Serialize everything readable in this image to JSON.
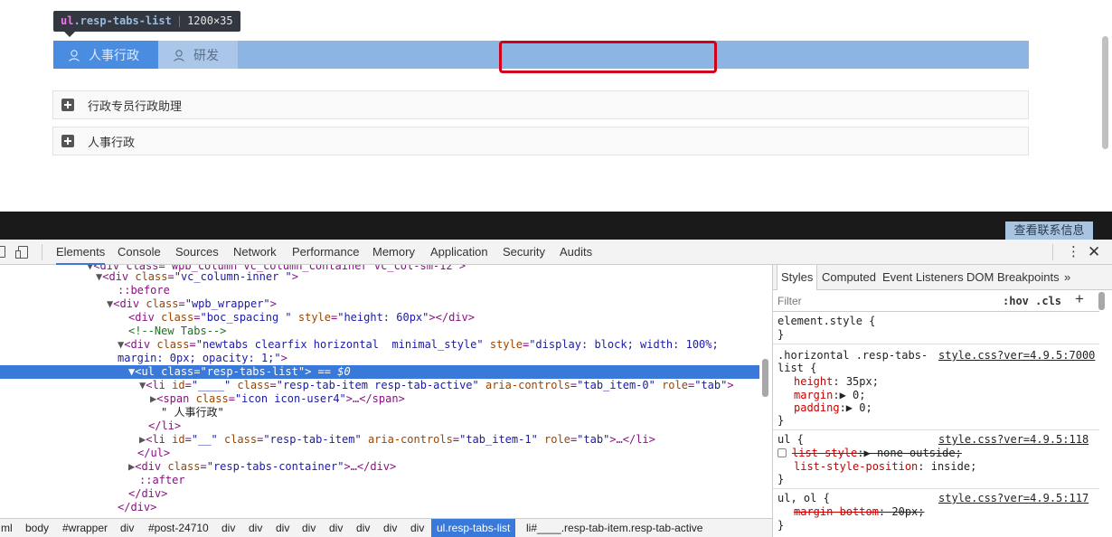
{
  "page": {
    "tooltip": {
      "tag": "ul",
      "class": ".resp-tabs-list",
      "dims": "1200×35"
    },
    "tabs": [
      {
        "label": "人事行政",
        "icon": "user-icon",
        "active": true
      },
      {
        "label": "研发",
        "icon": "user-icon",
        "active": false
      }
    ],
    "accordion": [
      {
        "label": "行政专员行政助理",
        "icon": "plus-icon"
      },
      {
        "label": "人事行政",
        "icon": "plus-icon"
      }
    ],
    "contact_button": "查看联系信息",
    "colors": {
      "tab_bar": "#8cb5e4",
      "tab_active": "#4a8ce0",
      "highlight": "#d0021b"
    }
  },
  "devtools": {
    "tabs": [
      "Elements",
      "Console",
      "Sources",
      "Network",
      "Performance",
      "Memory",
      "Application",
      "Security",
      "Audits"
    ],
    "selected_tab": "Elements",
    "dom_lines": {
      "l0": "<div class=\"wpb_column vc_column_container vc_col-sm-12\">",
      "l1_tag_open": "<div ",
      "l1_attr": "class",
      "l1_val": "\"vc_column-inner \"",
      "l1_close": ">",
      "l2": "::before",
      "l3_attr": "class",
      "l3_val": "\"wpb_wrapper\"",
      "l4_attr1": "class",
      "l4_val1": "\"boc_spacing \"",
      "l4_attr2": "style",
      "l4_val2": "\"height: 60px\"",
      "l5": "<!--New Tabs-->",
      "l6_attr1": "class",
      "l6_val1": "\"newtabs clearfix horizontal  minimal_style\"",
      "l6_attr2": "style",
      "l6_val2": "\"display: block; width: 100%;",
      "l7_val": "margin: 0px; opacity: 1;\"",
      "l8_attr": "class",
      "l8_val": "\"resp-tabs-list\"",
      "l8_eq": " == $0",
      "l9_attr1": "id",
      "l9_val1": "\"____\"",
      "l9_attr2": "class",
      "l9_val2": "\"resp-tab-item resp-tab-active\"",
      "l9_attr3": "aria-controls",
      "l9_val3": "\"tab_item-0\"",
      "l9_attr4": "role",
      "l9_val4": "\"tab\"",
      "l10_attr": "class",
      "l10_val": "\"icon icon-user4\"",
      "l11": "\" 人事行政\"",
      "l13_attr1": "id",
      "l13_val1": "\"__\"",
      "l13_attr2": "class",
      "l13_val2": "\"resp-tab-item\"",
      "l13_attr3": "aria-controls",
      "l13_val3": "\"tab_item-1\"",
      "l13_attr4": "role",
      "l13_val4": "\"tab\"",
      "l15_attr": "class",
      "l15_val": "\"resp-tabs-container\"",
      "l16": "::after"
    },
    "breadcrumbs": [
      "ml",
      "body",
      "#wrapper",
      "div",
      "#post-24710",
      "div",
      "div",
      "div",
      "div",
      "div",
      "div",
      "div",
      "div",
      "ul.resp-tabs-list",
      "li#____.resp-tab-item.resp-tab-active"
    ],
    "styles_tabs": [
      "Styles",
      "Computed",
      "Event Listeners",
      "DOM Breakpoints",
      "»"
    ],
    "filter_placeholder": "Filter",
    "hov_cls": ":hov  .cls",
    "rules": {
      "r1_sel": "element.style {",
      "r2_sel_a": ".horizontal .resp-tabs-",
      "r2_sel_b": "list {",
      "r2_src": "style.css?ver=4.9.5:7000",
      "r2_p1": "height",
      "r2_v1": "35px;",
      "r2_p2": "margin",
      "r2_v2": "0;",
      "r2_p3": "padding",
      "r2_v3": "0;",
      "r3_sel": "ul {",
      "r3_src": "style.css?ver=4.9.5:118",
      "r3_p1": "list-style",
      "r3_v1": "none outside;",
      "r3_p2": "list-style-position",
      "r3_v2": "inside;",
      "r4_sel": "ul, ol {",
      "r4_src": "style.css?ver=4.9.5:117",
      "r4_p1": "margin-bottom",
      "r4_v1": "20px;",
      "close": "}"
    }
  }
}
